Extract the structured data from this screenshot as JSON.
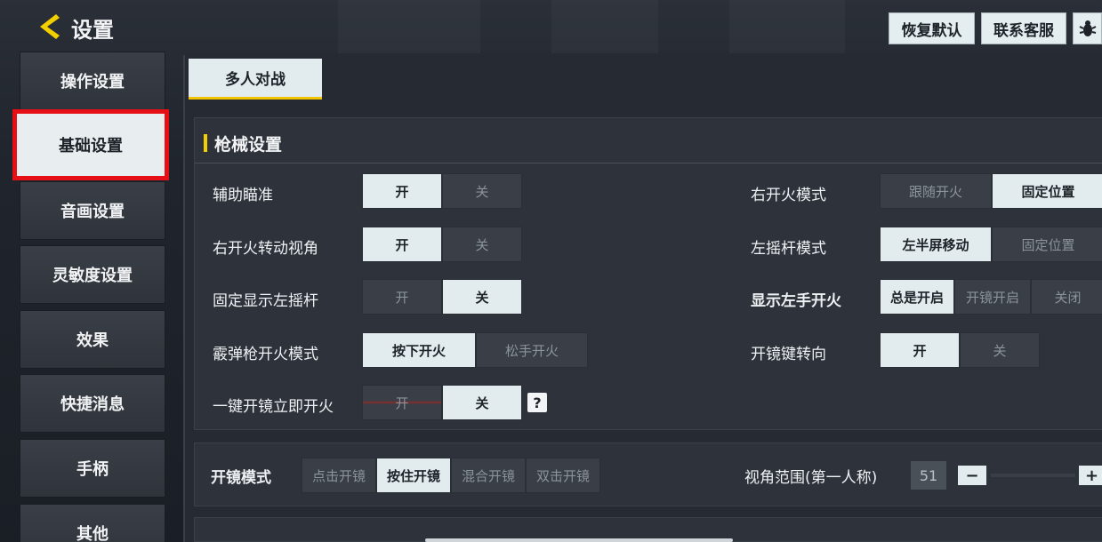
{
  "header": {
    "back_icon": "chevron-left-icon",
    "title": "设置",
    "buttons": {
      "restore_default": "恢复默认",
      "contact_support": "联系客服",
      "bug_icon": "bug-icon"
    }
  },
  "sidebar": {
    "items": [
      {
        "label": "操作设置",
        "active": false
      },
      {
        "label": "基础设置",
        "active": true
      },
      {
        "label": "音画设置",
        "active": false
      },
      {
        "label": "灵敏度设置",
        "active": false
      },
      {
        "label": "效果",
        "active": false
      },
      {
        "label": "快捷消息",
        "active": false
      },
      {
        "label": "手柄",
        "active": false
      },
      {
        "label": "其他",
        "active": false
      }
    ]
  },
  "main": {
    "mode_tab": "多人对战",
    "section_title": "枪械设置",
    "left_settings": [
      {
        "label": "辅助瞄准",
        "options": [
          "开",
          "关"
        ],
        "selected": "开"
      },
      {
        "label": "右开火转动视角",
        "options": [
          "开",
          "关"
        ],
        "selected": "开"
      },
      {
        "label": "固定显示左摇杆",
        "options": [
          "开",
          "关"
        ],
        "selected": "关"
      },
      {
        "label": "霰弹枪开火模式",
        "options": [
          "按下开火",
          "松手开火"
        ],
        "selected": "按下开火"
      },
      {
        "label": "一键开镜立即开火",
        "options": [
          "开",
          "关"
        ],
        "selected": "关"
      }
    ],
    "right_settings": [
      {
        "label": "右开火模式",
        "options": [
          "跟随开火",
          "固定位置"
        ],
        "selected": "固定位置"
      },
      {
        "label": "左摇杆模式",
        "options": [
          "左半屏移动",
          "固定位置"
        ],
        "selected": "左半屏移动"
      },
      {
        "label": "显示左手开火",
        "options": [
          "总是开启",
          "开镜开启",
          "关闭"
        ],
        "selected": "总是开启"
      },
      {
        "label": "开镜键转向",
        "options": [
          "开",
          "关"
        ],
        "selected": "开"
      }
    ],
    "help_icon": "question-icon",
    "help_text": "?",
    "scope": {
      "label": "开镜模式",
      "options": [
        "点击开镜",
        "按住开镜",
        "混合开镜",
        "双击开镜"
      ],
      "selected": "按住开镜"
    },
    "fov": {
      "label": "视角范围(第一人称)",
      "value": "51",
      "minus": "−",
      "plus": "+"
    }
  },
  "colors": {
    "accent_yellow": "#f4cf00",
    "highlight_red": "#e60f15",
    "active_bg": "#e2ecee"
  }
}
